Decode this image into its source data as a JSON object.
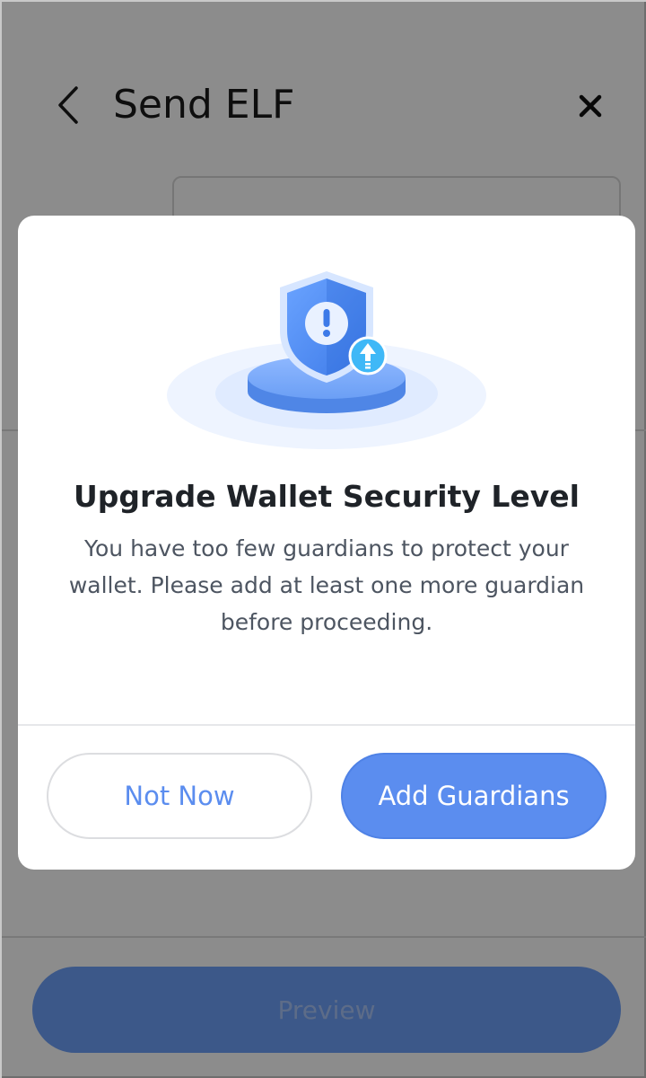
{
  "header": {
    "title": "Send ELF",
    "back_icon": "chevron-left-icon",
    "close_icon": "close-icon"
  },
  "footer": {
    "preview_label": "Preview"
  },
  "modal": {
    "illustration_icon": "shield-warning-upgrade-icon",
    "title": "Upgrade Wallet Security Level",
    "message": "You have too few guardians to protect your wallet. Please add at least one more guardian before proceeding.",
    "secondary_label": "Not Now",
    "primary_label": "Add Guardians"
  },
  "colors": {
    "accent": "#5b8def",
    "overlay": "#000000",
    "text_primary": "#1f2328",
    "text_secondary": "#4d5561"
  }
}
